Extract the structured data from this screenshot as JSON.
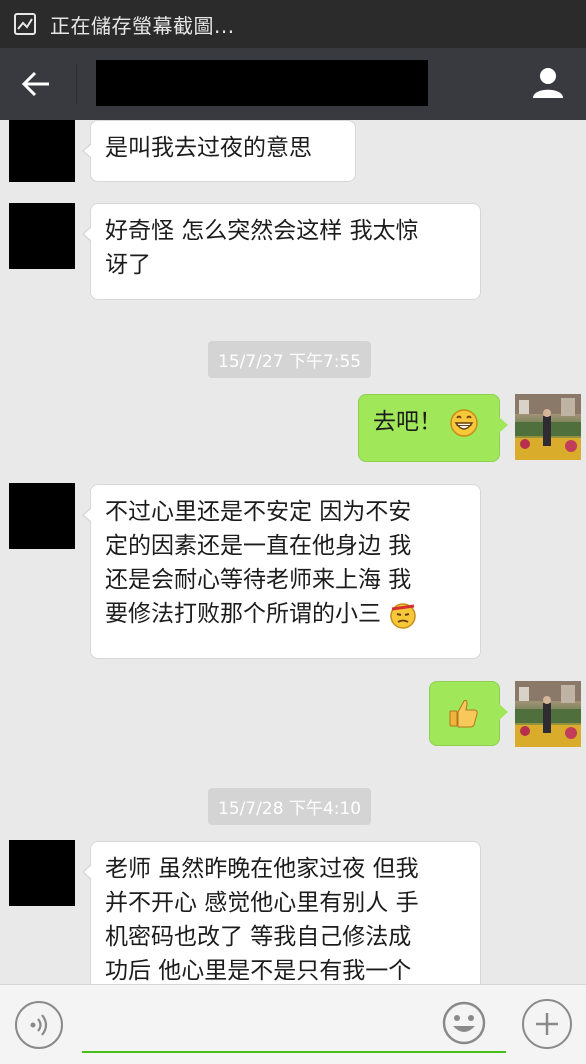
{
  "status_bar": {
    "icon": "screenshot-icon",
    "text": "正在儲存螢幕截圖..."
  },
  "title_bar": {
    "back_icon": "arrow-left-icon",
    "contact_name": "",
    "profile_icon": "person-icon"
  },
  "messages": [
    {
      "side": "left",
      "text": "是叫我去过夜的意思"
    },
    {
      "side": "left",
      "text_lines": [
        "好奇怪 怎么突然会这样 我太惊",
        "讶了"
      ]
    },
    {
      "type": "timestamp",
      "text": "15/7/27 下午7:55"
    },
    {
      "side": "right",
      "text": "去吧！",
      "emoji": "grinning-face-icon"
    },
    {
      "side": "left",
      "text_lines": [
        "不过心里还是不安定 因为不安",
        "定的因素还是一直在他身边 我",
        "还是会耐心等待老师来上海 我",
        "要修法打败那个所谓的小三"
      ],
      "emoji": "determined-face-icon"
    },
    {
      "side": "right",
      "emoji": "thumbs-up-icon"
    },
    {
      "type": "timestamp",
      "text": "15/7/28 下午4:10"
    },
    {
      "side": "left",
      "text_lines": [
        "老师 虽然昨晚在他家过夜 但我",
        "并不开心 感觉他心里有别人 手",
        "机密码也改了 等我自己修法成",
        "功后 他心里是不是只有我一个"
      ]
    }
  ],
  "input_bar": {
    "voice_icon": "voice-icon",
    "input_value": "",
    "emoji_icon": "smiley-icon",
    "plus_icon": "plus-icon"
  },
  "colors": {
    "status_bar_bg": "#2b2b2b",
    "title_bar_bg": "#393a3f",
    "chat_bg": "#e9e9e9",
    "outgoing_bubble": "#a0e75a",
    "incoming_bubble": "#ffffff",
    "input_underline": "#45c01a"
  }
}
